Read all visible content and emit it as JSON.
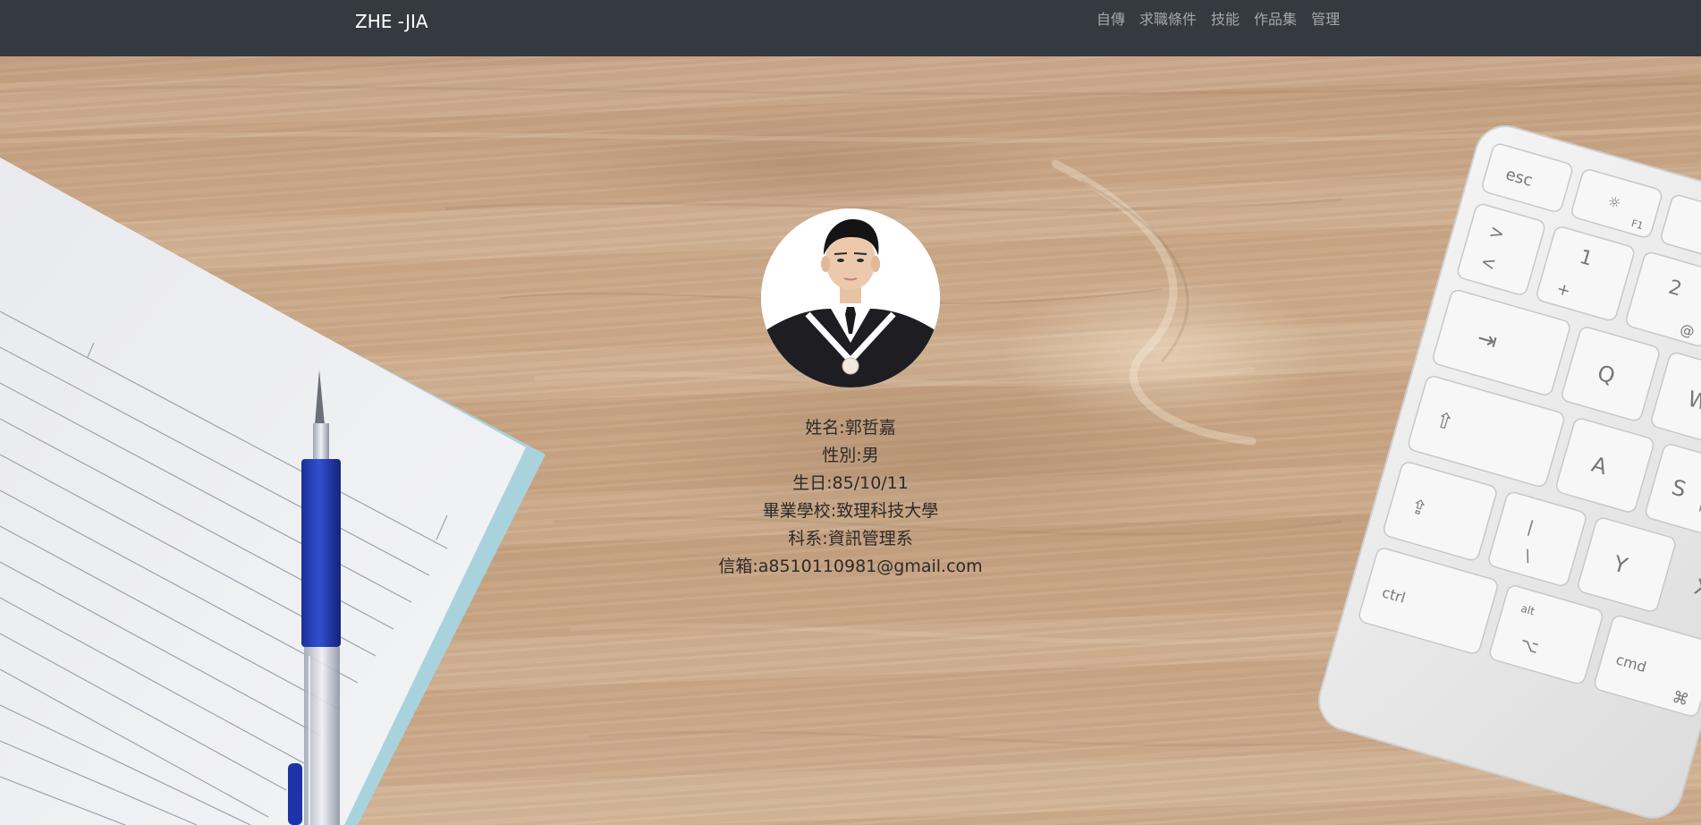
{
  "navbar": {
    "brand": "ZHE -JIA",
    "links": [
      "自傳",
      "求職條件",
      "技能",
      "作品集",
      "管理"
    ]
  },
  "profile": {
    "photo_alt": "profile-photo",
    "name": "姓名:郭哲嘉",
    "gender": "性別:男",
    "birthday": "生日:85/10/11",
    "school": "畢業學校:致理科技大學",
    "department": "科系:資訊管理系",
    "email": "信箱:a8510110981@gmail.com"
  },
  "colors": {
    "navbar": "#343a40",
    "brand": "#ffffff",
    "nav_link": "#9a9da0",
    "desk": "#c9a886",
    "text": "#2d2a2a"
  },
  "keyboard": {
    "keys": [
      "esc",
      "☼",
      "F1",
      ">",
      "<",
      "1",
      "+",
      "2",
      "@",
      "⇥",
      "Q",
      "W",
      "⇧",
      "A",
      "S",
      "ß",
      "⇪",
      "|",
      "\\",
      "Y",
      "X",
      "ctrl",
      "alt",
      "⌥",
      "cmd",
      "⌘"
    ]
  }
}
